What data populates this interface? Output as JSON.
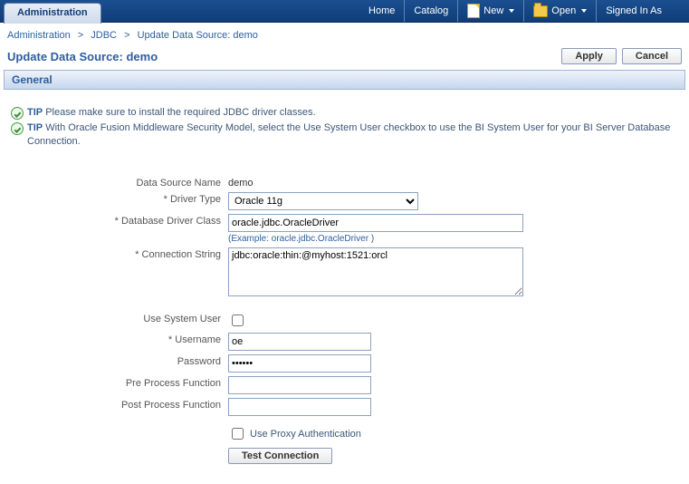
{
  "topbar": {
    "tab": "Administration",
    "home": "Home",
    "catalog": "Catalog",
    "new": "New",
    "open": "Open",
    "signed_in": "Signed In As"
  },
  "breadcrumb": {
    "admin": "Administration",
    "jdbc": "JDBC",
    "current": "Update Data Source: demo"
  },
  "page": {
    "title": "Update Data Source: demo",
    "apply": "Apply",
    "cancel": "Cancel"
  },
  "section": {
    "general": "General"
  },
  "tips": {
    "tip_label": "TIP",
    "tip1": "Please make sure to install the required JDBC driver classes.",
    "tip2": "With Oracle Fusion Middleware Security Model, select the Use System User checkbox to use the BI System User for your BI Server Database Connection."
  },
  "form": {
    "data_source_name_label": "Data Source Name",
    "data_source_name_value": "demo",
    "driver_type_label": "* Driver Type",
    "driver_type_value": "Oracle 11g",
    "driver_class_label": "* Database Driver Class",
    "driver_class_value": "oracle.jdbc.OracleDriver",
    "driver_class_example": "(Example: oracle.jdbc.OracleDriver )",
    "connection_string_label": "* Connection String",
    "connection_string_value": "jdbc:oracle:thin:@myhost:1521:orcl",
    "use_system_user_label": "Use System User",
    "username_label": "* Username",
    "username_value": "oe",
    "password_label": "Password",
    "password_value": "••••••",
    "pre_process_label": "Pre Process Function",
    "pre_process_value": "",
    "post_process_label": "Post Process Function",
    "post_process_value": "",
    "use_proxy_label": "Use Proxy Authentication",
    "test_connection": "Test Connection"
  }
}
